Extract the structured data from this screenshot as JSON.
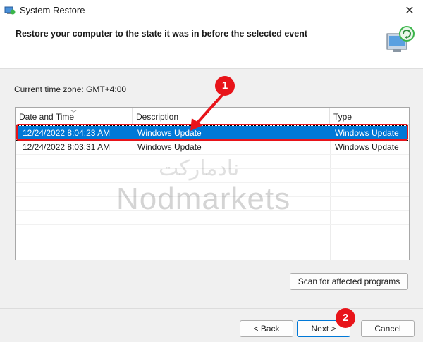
{
  "window": {
    "title": "System Restore",
    "close_glyph": "✕"
  },
  "header": {
    "text": "Restore your computer to the state it was in before the selected event"
  },
  "timezone": "Current time zone: GMT+4:00",
  "table": {
    "columns": [
      "Date and Time",
      "Description",
      "Type"
    ],
    "rows": [
      {
        "date": "12/24/2022 8:04:23 AM",
        "description": "Windows Update",
        "type": "Windows Update",
        "selected": true
      },
      {
        "date": "12/24/2022 8:03:31 AM",
        "description": "Windows Update",
        "type": "Windows Update",
        "selected": false
      }
    ]
  },
  "watermark": {
    "fa": "نادمارکت",
    "en": "Nodmarkets"
  },
  "buttons": {
    "scan": "Scan for affected programs",
    "back": "< Back",
    "next": "Next >",
    "cancel": "Cancel"
  },
  "annotations": {
    "badge1": "1",
    "badge2": "2",
    "color": "#e8141a"
  },
  "icons": {
    "app": "system-restore-icon",
    "header": "computer-restore-icon",
    "close": "close-icon"
  }
}
